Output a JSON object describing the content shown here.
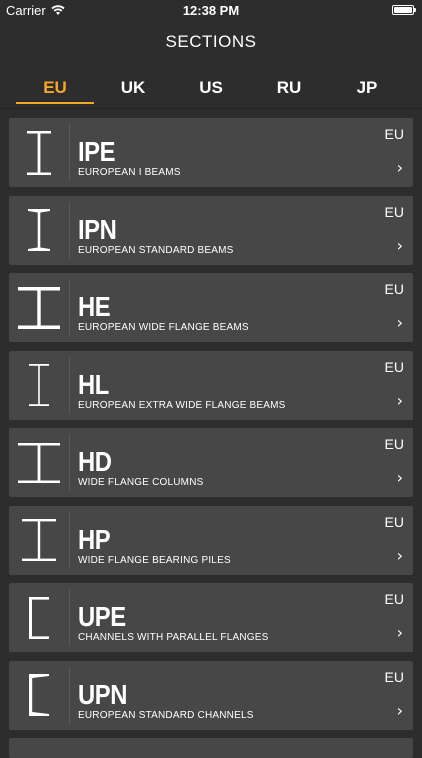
{
  "status_bar": {
    "carrier": "Carrier",
    "time": "12:38 PM"
  },
  "header": {
    "title": "SECTIONS"
  },
  "tabs": [
    {
      "label": "EU",
      "active": true
    },
    {
      "label": "UK",
      "active": false
    },
    {
      "label": "US",
      "active": false
    },
    {
      "label": "RU",
      "active": false
    },
    {
      "label": "JP",
      "active": false
    }
  ],
  "sections": [
    {
      "code": "IPE",
      "description": "EUROPEAN I BEAMS",
      "region": "EU",
      "icon": "i-beam-icon"
    },
    {
      "code": "IPN",
      "description": "EUROPEAN STANDARD BEAMS",
      "region": "EU",
      "icon": "i-beam-icon"
    },
    {
      "code": "HE",
      "description": "EUROPEAN WIDE FLANGE BEAMS",
      "region": "EU",
      "icon": "h-beam-icon"
    },
    {
      "code": "HL",
      "description": "EUROPEAN EXTRA WIDE FLANGE BEAMS",
      "region": "EU",
      "icon": "i-beam-icon"
    },
    {
      "code": "HD",
      "description": "WIDE FLANGE COLUMNS",
      "region": "EU",
      "icon": "h-beam-icon"
    },
    {
      "code": "HP",
      "description": "WIDE FLANGE BEARING PILES",
      "region": "EU",
      "icon": "h-beam-icon"
    },
    {
      "code": "UPE",
      "description": "CHANNELS WITH PARALLEL FLANGES",
      "region": "EU",
      "icon": "channel-icon"
    },
    {
      "code": "UPN",
      "description": "EUROPEAN STANDARD CHANNELS",
      "region": "EU",
      "icon": "channel-icon"
    }
  ],
  "colors": {
    "accent": "#f5a623",
    "background": "#2d2d2d",
    "row": "#474747"
  }
}
